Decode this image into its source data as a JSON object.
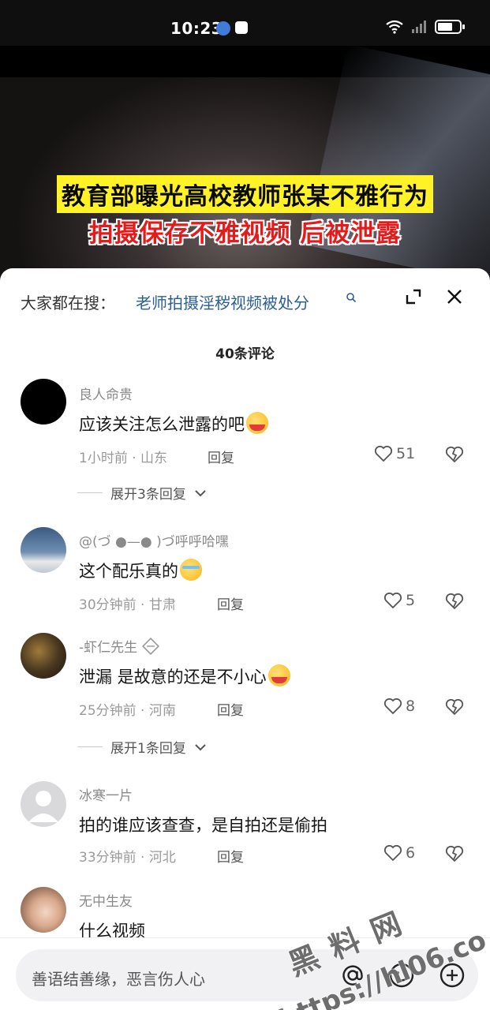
{
  "status_bar": {
    "time": "10:23"
  },
  "video": {
    "caption_line1": "教育部曝光高校教师张某不雅行为",
    "caption_line2": "拍摄保存不雅视频 后被泄露"
  },
  "search": {
    "prefix": "大家都在搜：",
    "term": "老师拍摄淫秽视频被处分"
  },
  "comments_title": "40条评论",
  "comments": [
    {
      "user": "良人命贵",
      "text": "应该关注怎么泄露的吧",
      "time_loc": "1小时前 · 山东",
      "reply": "回复",
      "likes": "51",
      "expand": "展开3条回复"
    },
    {
      "user": "@(づ ●—● )づ呼呼哈嘿",
      "text": "这个配乐真的",
      "time_loc": "30分钟前 · 甘肃",
      "reply": "回复",
      "likes": "5"
    },
    {
      "user": "-虾仁先生",
      "text": "泄漏 是故意的还是不小心",
      "time_loc": "25分钟前 · 河南",
      "reply": "回复",
      "likes": "8",
      "expand": "展开1条回复"
    },
    {
      "user": "冰寒一片",
      "text": "拍的谁应该查查，是自拍还是偷拍",
      "time_loc": "33分钟前 · 河北",
      "reply": "回复",
      "likes": "6"
    },
    {
      "user": "无中生友",
      "text": "什么视频"
    }
  ],
  "input": {
    "placeholder": "善语结善缘，恶言伤人心"
  },
  "watermark": {
    "line1": "黑料网",
    "line2": "https://hl06.co"
  }
}
